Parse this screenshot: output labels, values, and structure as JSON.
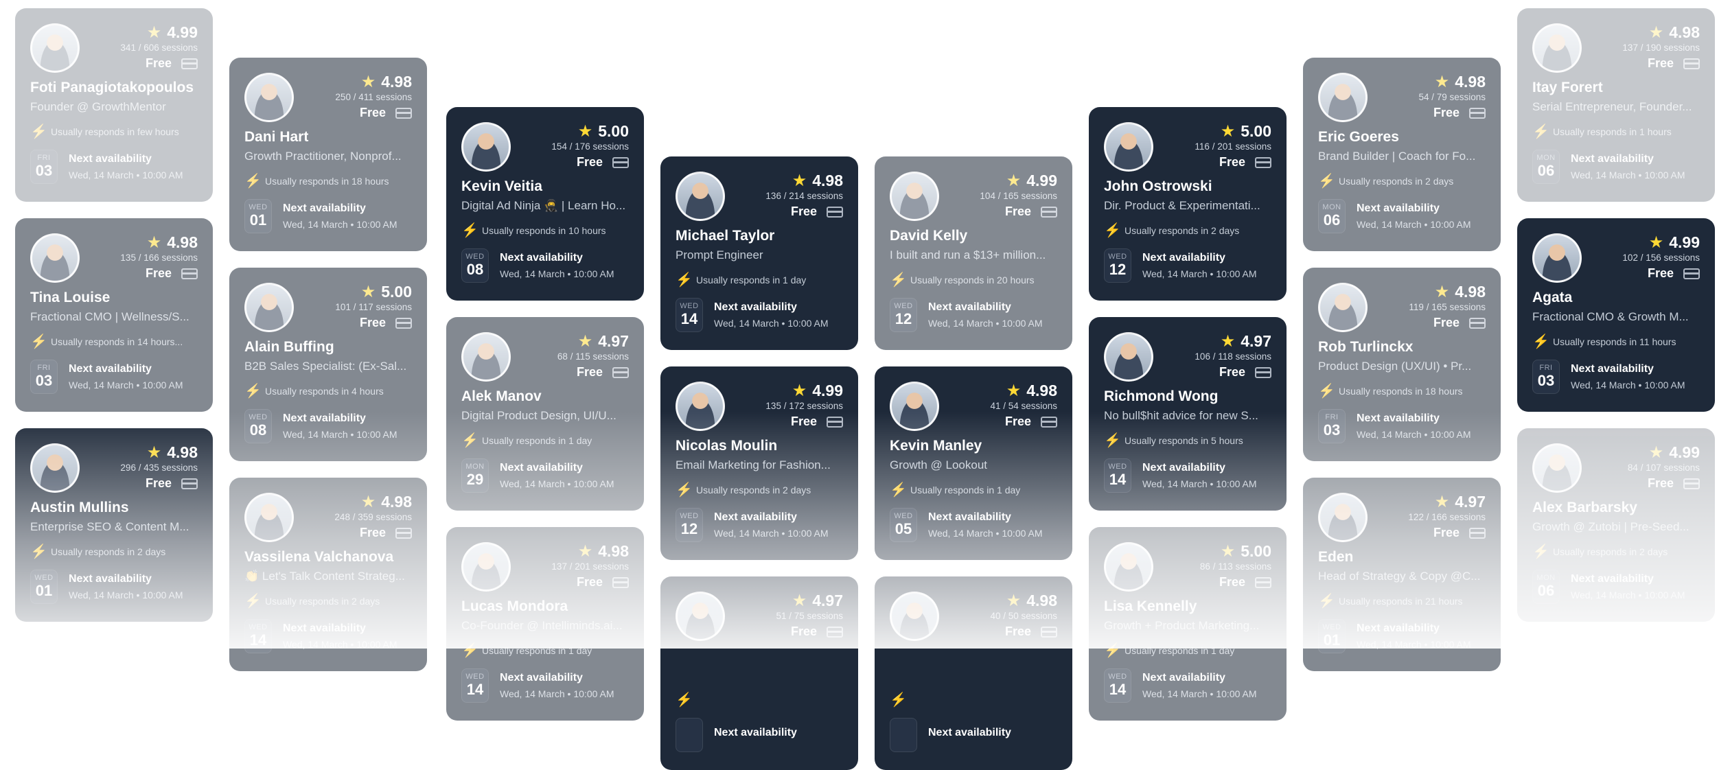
{
  "currency_label": "Free",
  "availability_label": "Next availability",
  "cards": [
    {
      "name": "Foti Panagiotakopoulos",
      "headline": "Founder @ GrowthMentor",
      "rating": "4.99",
      "sessions": "341 / 606 sessions",
      "responds": "Usually responds in few hours",
      "dow": "FRI",
      "day": "03",
      "date": "Wed, 14 March • 10:00 AM"
    },
    {
      "name": "Tina Louise",
      "headline": "Fractional CMO | Wellness/S...",
      "rating": "4.98",
      "sessions": "135 / 166 sessions",
      "responds": "Usually responds in 14 hours...",
      "dow": "FRI",
      "day": "03",
      "date": "Wed, 14 March • 10:00 AM"
    },
    {
      "name": "Austin Mullins",
      "headline": "Enterprise SEO & Content M...",
      "rating": "4.98",
      "sessions": "296 / 435 sessions",
      "responds": "Usually responds in 2 days",
      "dow": "WED",
      "day": "01",
      "date": "Wed, 14 March • 10:00 AM"
    },
    {
      "name": "Dani Hart",
      "headline": "Growth Practitioner, Nonprof...",
      "rating": "4.98",
      "sessions": "250 / 411 sessions",
      "responds": "Usually responds in 18 hours",
      "dow": "WED",
      "day": "01",
      "date": "Wed, 14 March • 10:00 AM"
    },
    {
      "name": "Alain Buffing",
      "headline": "B2B Sales Specialist: (Ex-Sal...",
      "rating": "5.00",
      "sessions": "101 / 117 sessions",
      "responds": "Usually responds in 4 hours",
      "dow": "WED",
      "day": "08",
      "date": "Wed, 14 March • 10:00 AM"
    },
    {
      "name": "Vassilena Valchanova",
      "headline": "👏 Let's Talk Content Strateg...",
      "rating": "4.98",
      "sessions": "248 / 359 sessions",
      "responds": "Usually responds in 2 days",
      "dow": "WED",
      "day": "14",
      "date": "Wed, 14 March • 10:00 AM"
    },
    {
      "name": "Kevin Veitia",
      "headline": "Digital Ad Ninja 🥷 | Learn Ho...",
      "rating": "5.00",
      "sessions": "154 / 176 sessions",
      "responds": "Usually responds in 10 hours",
      "dow": "WED",
      "day": "08",
      "date": "Wed, 14 March • 10:00 AM"
    },
    {
      "name": "Alek Manov",
      "headline": "Digital Product Design, UI/U...",
      "rating": "4.97",
      "sessions": "68 / 115 sessions",
      "responds": "Usually responds in 1 day",
      "dow": "MON",
      "day": "29",
      "date": "Wed, 14 March • 10:00 AM"
    },
    {
      "name": "Lucas Mondora",
      "headline": "Co-Founder @ Intelliminds.ai...",
      "rating": "4.98",
      "sessions": "137 / 201 sessions",
      "responds": "Usually responds in 1 day",
      "dow": "WED",
      "day": "14",
      "date": "Wed, 14 March • 10:00 AM"
    },
    {
      "name": "Michael Taylor",
      "headline": "Prompt Engineer",
      "rating": "4.98",
      "sessions": "136 / 214 sessions",
      "responds": "Usually responds in 1 day",
      "dow": "WED",
      "day": "14",
      "date": "Wed, 14 March • 10:00 AM"
    },
    {
      "name": "Nicolas Moulin",
      "headline": "Email Marketing for Fashion...",
      "rating": "4.99",
      "sessions": "135 / 172 sessions",
      "responds": "Usually responds in 2 days",
      "dow": "WED",
      "day": "12",
      "date": "Wed, 14 March • 10:00 AM"
    },
    {
      "name": "",
      "headline": "",
      "rating": "4.97",
      "sessions": "51 / 75 sessions",
      "responds": "",
      "dow": "",
      "day": "",
      "date": ""
    },
    {
      "name": "David Kelly",
      "headline": "I built and run a $13+ million...",
      "rating": "4.99",
      "sessions": "104 / 165 sessions",
      "responds": "Usually responds in 20 hours",
      "dow": "WED",
      "day": "12",
      "date": "Wed, 14 March • 10:00 AM"
    },
    {
      "name": "Kevin Manley",
      "headline": "Growth @ Lookout",
      "rating": "4.98",
      "sessions": "41 / 54 sessions",
      "responds": "Usually responds in 1 day",
      "dow": "WED",
      "day": "05",
      "date": "Wed, 14 March • 10:00 AM"
    },
    {
      "name": "",
      "headline": "",
      "rating": "4.98",
      "sessions": "40 / 50 sessions",
      "responds": "",
      "dow": "",
      "day": "",
      "date": ""
    },
    {
      "name": "John Ostrowski",
      "headline": "Dir. Product & Experimentati...",
      "rating": "5.00",
      "sessions": "116 / 201 sessions",
      "responds": "Usually responds in 2 days",
      "dow": "WED",
      "day": "12",
      "date": "Wed, 14 March • 10:00 AM"
    },
    {
      "name": "Richmond Wong",
      "headline": "No bull$hit advice for new S...",
      "rating": "4.97",
      "sessions": "106 / 118 sessions",
      "responds": "Usually responds in 5 hours",
      "dow": "WED",
      "day": "14",
      "date": "Wed, 14 March • 10:00 AM"
    },
    {
      "name": "Lisa Kennelly",
      "headline": "Growth + Product Marketing...",
      "rating": "5.00",
      "sessions": "86 / 113 sessions",
      "responds": "Usually responds in 1 day",
      "dow": "WED",
      "day": "14",
      "date": "Wed, 14 March • 10:00 AM"
    },
    {
      "name": "Eric Goeres",
      "headline": "Brand Builder | Coach for Fo...",
      "rating": "4.98",
      "sessions": "54 / 79 sessions",
      "responds": "Usually responds in 2 days",
      "dow": "MON",
      "day": "06",
      "date": "Wed, 14 March • 10:00 AM"
    },
    {
      "name": "Rob Turlinckx",
      "headline": "Product Design (UX/UI) • Pr...",
      "rating": "4.98",
      "sessions": "119 / 165 sessions",
      "responds": "Usually responds in 18 hours",
      "dow": "FRI",
      "day": "03",
      "date": "Wed, 14 March • 10:00 AM"
    },
    {
      "name": "Eden",
      "headline": "Head of Strategy & Copy @C...",
      "rating": "4.97",
      "sessions": "122 / 166 sessions",
      "responds": "Usually responds in 21 hours",
      "dow": "WED",
      "day": "01",
      "date": "Wed, 14 March • 10:00 AM"
    },
    {
      "name": "Itay Forert",
      "headline": "Serial Entrepreneur, Founder...",
      "rating": "4.98",
      "sessions": "137 / 190 sessions",
      "responds": "Usually responds in 1 hours",
      "dow": "MON",
      "day": "06",
      "date": "Wed, 14 March • 10:00 AM"
    },
    {
      "name": "Agata",
      "headline": "Fractional CMO & Growth M...",
      "rating": "4.99",
      "sessions": "102 / 156 sessions",
      "responds": "Usually responds in 11 hours",
      "dow": "FRI",
      "day": "03",
      "date": "Wed, 14 March • 10:00 AM"
    },
    {
      "name": "Alex Barbarsky",
      "headline": "Growth @ Zutobi | Pre-Seed...",
      "rating": "4.99",
      "sessions": "84 / 107 sessions",
      "responds": "Usually responds in 2 days",
      "dow": "MON",
      "day": "06",
      "date": "Wed, 14 March • 10:00 AM"
    }
  ]
}
